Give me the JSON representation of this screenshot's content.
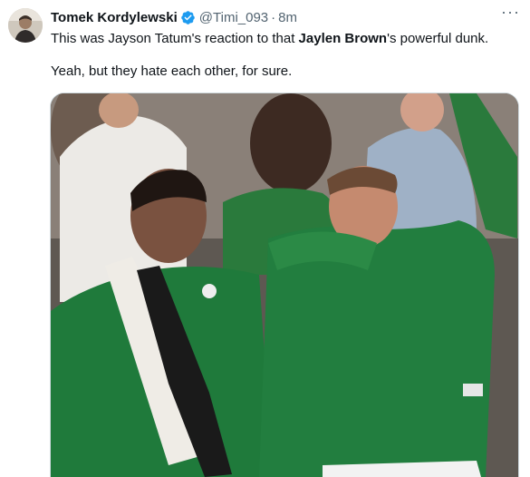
{
  "tweet": {
    "author_name": "Tomek Kordylewski",
    "handle": "@Timi_093",
    "separator": "·",
    "time": "8m",
    "more_label": "···",
    "text_line1_before": "This was Jayson Tatum's reaction to that ",
    "text_line1_bold": "Jaylen Brown",
    "text_line1_after": "'s powerful dunk.",
    "text_line2": "Yeah, but they hate each other, for sure."
  },
  "icons": {
    "verified": "verified-badge-icon",
    "more": "more-options-icon"
  },
  "colors": {
    "verified_blue": "#1d9bf0",
    "secondary_text": "#536471",
    "celtics_green": "#1e7a3c"
  }
}
